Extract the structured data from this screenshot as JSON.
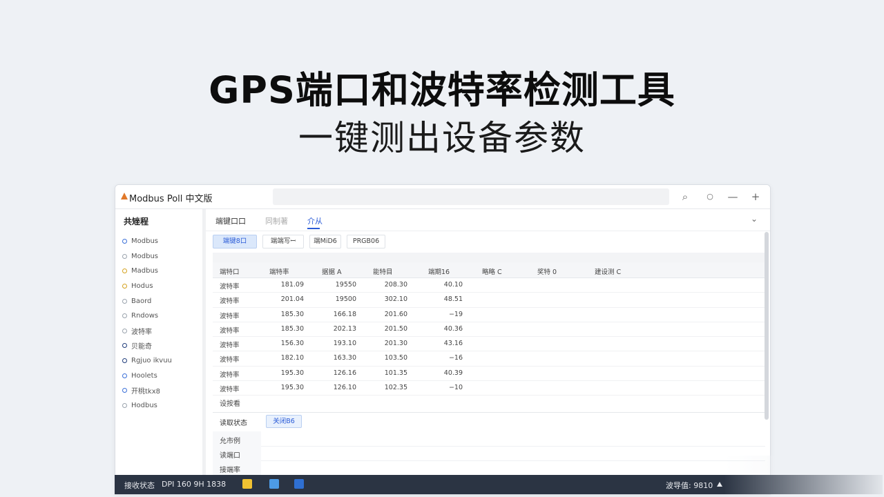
{
  "hero": {
    "title": "GPS端口和波特率检测工具",
    "subtitle": "一键测出设备参数"
  },
  "window": {
    "title": "Modbus Poll 中文版",
    "controls": [
      "⌕",
      "○",
      "—",
      "+"
    ]
  },
  "sidebar": {
    "header": "共矬程",
    "items": [
      {
        "label": "Modbus",
        "color": "#3a6fd8"
      },
      {
        "label": "Modbus",
        "color": "#9aa3ad"
      },
      {
        "label": "Madbus",
        "color": "#d4a21f"
      },
      {
        "label": "Hodus",
        "color": "#d4a21f"
      },
      {
        "label": "Baord",
        "color": "#9aa3ad"
      },
      {
        "label": "Rndows",
        "color": "#9aa3ad"
      },
      {
        "label": "波特率",
        "color": "#9aa3ad"
      },
      {
        "label": "贝能奇",
        "color": "#1f3c7a"
      },
      {
        "label": "Rgjuo ikvuu",
        "color": "#1f3c7a"
      },
      {
        "label": "Hoolets",
        "color": "#3a6fd8"
      },
      {
        "label": "开桃tkx8",
        "color": "#3a6fd8"
      },
      {
        "label": "Hodbus",
        "color": "#9aa3ad"
      }
    ]
  },
  "tabs": [
    {
      "label": "端键口口",
      "state": "normal"
    },
    {
      "label": "同制著",
      "state": "dim"
    },
    {
      "label": "介从",
      "state": "active"
    }
  ],
  "subtabs": [
    {
      "label": "端键8口",
      "active": true
    },
    {
      "label": "端端写ꟷ",
      "active": false
    },
    {
      "label": "端MiD6",
      "active": false
    },
    {
      "label": "PRGB06",
      "active": false
    }
  ],
  "table": {
    "headers": [
      "端特口",
      "端特率",
      "据据 A",
      "能特目",
      "端期16",
      "略略 C",
      "奖特 0",
      "建设测 C"
    ],
    "rows": [
      [
        "波特率",
        "181.09",
        "19550",
        "208.30",
        "40.10"
      ],
      [
        "波特率",
        "201.04",
        "19500",
        "302.10",
        "48.51"
      ],
      [
        "波特率",
        "185.30",
        "166.18",
        "201.60",
        "−19"
      ],
      [
        "波特率",
        "185.30",
        "202.13",
        "201.50",
        "40.36"
      ],
      [
        "波特率",
        "156.30",
        "193.10",
        "201.30",
        "43.16"
      ],
      [
        "波特率",
        "182.10",
        "163.30",
        "103.50",
        "−16"
      ],
      [
        "波特率",
        "195.30",
        "126.16",
        "101.35",
        "40.39"
      ],
      [
        "波特率",
        "195.30",
        "126.10",
        "102.35",
        "−10"
      ]
    ]
  },
  "settings_label": "设按看",
  "status": {
    "label": "读取状态",
    "value": "关闭B6"
  },
  "bottom_list": [
    "允市例",
    "读端口",
    "接端率"
  ],
  "statusbar": {
    "left_label": "接收状态",
    "left_value": "DPI 160 9H 1838",
    "right_text": "波导值: 9810"
  }
}
